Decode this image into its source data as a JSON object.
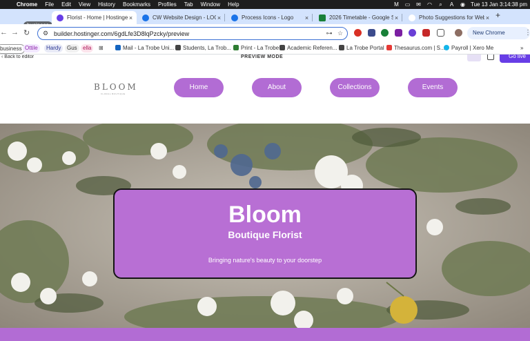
{
  "menubar": {
    "app": "Chrome",
    "items": [
      "File",
      "Edit",
      "View",
      "History",
      "Bookmarks",
      "Profiles",
      "Tab",
      "Window",
      "Help"
    ],
    "status_icons": [
      "m-icon",
      "battery-icon",
      "mail-icon",
      "wifi-icon",
      "search-icon",
      "a-icon",
      "control-center-icon"
    ],
    "clock": "Tue 13 Jan  3:14:38 pm"
  },
  "tabs": {
    "group": "business",
    "list": [
      {
        "title": "Florist - Home | Hostinger W...",
        "favicon_color": "#673de6"
      },
      {
        "title": "CW Website Design - LOGO...",
        "favicon_color": "#1a73e8"
      },
      {
        "title": "Process Icons - Logo",
        "favicon_color": "#1a73e8"
      },
      {
        "title": "2026 Timetable - Google She...",
        "favicon_color": "#188038"
      },
      {
        "title": "Photo Suggestions for Webs...",
        "favicon_color": "#ffffff"
      }
    ],
    "new_tab": "+"
  },
  "toolbar": {
    "url": "builder.hostinger.com/6gdLfe3D8lqPzcky/preview",
    "update_button": "New Chrome available"
  },
  "bookmarks": {
    "chips": [
      "business",
      "Ottile",
      "Hardy",
      "Gus",
      "ella"
    ],
    "items": [
      "Mail - La Trobe Uni...",
      "Students, La Trob...",
      "Print - La Trobe",
      "Academic Referen...",
      "La Trobe Portal",
      "Thesaurus.com | S...",
      "Payroll | Xero Me"
    ],
    "more": "»"
  },
  "editor": {
    "back_label": "Back to editor",
    "mode_label": "PREVIEW MODE",
    "go_live": "Go live"
  },
  "site": {
    "logo_text": "BLOOM",
    "logo_tagline": "FLORAL BOUTIQUE",
    "nav": [
      "Home",
      "About",
      "Collections",
      "Events"
    ],
    "hero_title": "Bloom",
    "hero_subtitle": "Boutique Florist",
    "hero_tagline": "Bringing nature's beauty to your doorstep"
  },
  "colors": {
    "accent": "#b26cd4",
    "hostinger_purple": "#673de6",
    "chrome_tab_strip": "#d3e3fd"
  }
}
